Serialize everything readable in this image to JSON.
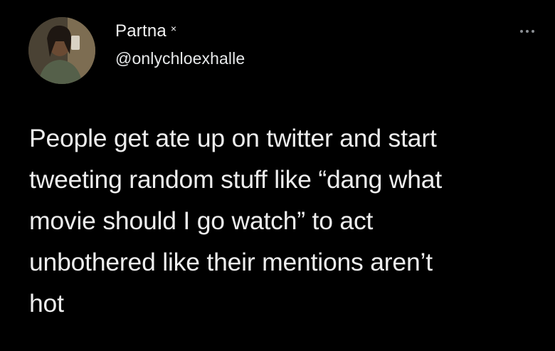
{
  "tweet": {
    "author": {
      "display_name": "Partna",
      "name_suffix": "×",
      "handle": "@onlychloexhalle",
      "avatar_icon": "profile-photo"
    },
    "more_icon": "more-horizontal-icon",
    "text_lines": [
      "People get ate up on twitter and start",
      "tweeting random stuff like “dang what",
      "movie should I go watch” to act",
      "unbothered like their mentions aren’t",
      "hot"
    ]
  },
  "colors": {
    "background": "#000000",
    "text": "#eeeeee",
    "muted": "#8b8f94"
  }
}
